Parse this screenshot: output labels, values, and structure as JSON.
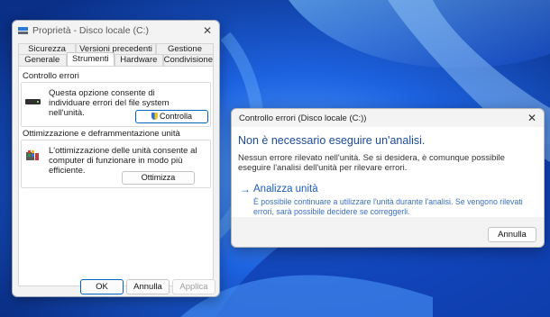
{
  "colors": {
    "accent": "#0067c0",
    "link_blue": "#1a5bb8",
    "wallpaper": "#0b3fb0"
  },
  "properties_dialog": {
    "title": "Proprietà - Disco locale (C:)",
    "tabs_row1": [
      "Sicurezza",
      "Versioni precedenti",
      "Gestione quote"
    ],
    "tabs_row2": [
      "Generale",
      "Strumenti",
      "Hardware",
      "Condivisione"
    ],
    "active_tab": "Strumenti",
    "error_check": {
      "label": "Controllo errori",
      "text": "Questa opzione consente di individuare errori del file system nell'unità.",
      "button": "Controlla",
      "icon": "drive-icon"
    },
    "optimize": {
      "label": "Ottimizzazione e deframmentazione unità",
      "text": "L'ottimizzazione delle unità consente al computer di funzionare in modo più efficiente.",
      "button": "Ottimizza",
      "icon": "defrag-icon"
    },
    "footer": {
      "ok": "OK",
      "cancel": "Annulla",
      "apply": "Applica"
    }
  },
  "check_dialog": {
    "title": "Controllo errori (Disco locale (C:))",
    "heading": "Non è necessario eseguire un'analisi.",
    "description": "Nessun errore rilevato nell'unità. Se si desidera, è comunque possibile eseguire l'analisi dell'unità per rilevare errori.",
    "action_title": "Analizza unità",
    "action_desc": "È possibile continuare a utilizzare l'unità durante l'analisi. Se vengono rilevati errori, sarà possibile decidere se correggerli.",
    "cancel": "Annulla"
  }
}
